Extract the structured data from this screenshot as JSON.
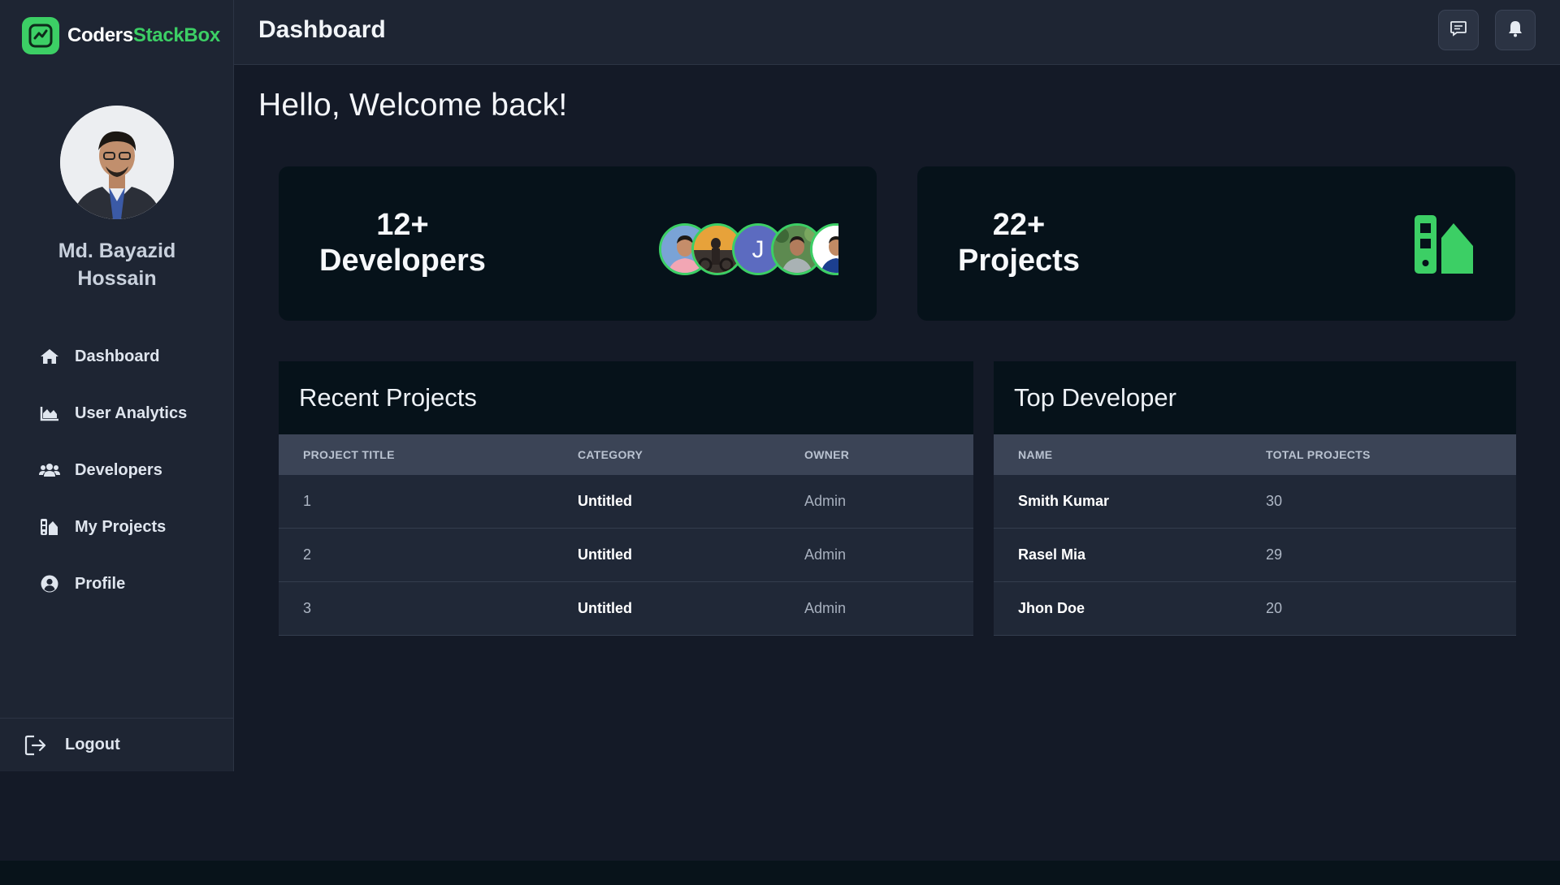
{
  "brand": {
    "name_part1": "Coders",
    "name_part2": "StackBox",
    "accent": "#3ccf65"
  },
  "user": {
    "name_line1": "Md. Bayazid",
    "name_line2": "Hossain"
  },
  "sidebar": {
    "items": [
      {
        "label": "Dashboard",
        "icon": "home-icon"
      },
      {
        "label": "User Analytics",
        "icon": "area-chart-icon"
      },
      {
        "label": "Developers",
        "icon": "users-icon"
      },
      {
        "label": "My Projects",
        "icon": "swatchbook-icon"
      },
      {
        "label": "Profile",
        "icon": "user-circle-icon"
      }
    ],
    "logout_label": "Logout"
  },
  "topbar": {
    "title": "Dashboard",
    "buttons": [
      "message-icon",
      "bell-icon"
    ]
  },
  "main": {
    "welcome": "Hello, Welcome back!",
    "stats": {
      "developers": {
        "value": "12+",
        "label": "Developers"
      },
      "projects": {
        "value": "22+",
        "label": "Projects"
      }
    },
    "developer_avatars": [
      "photo",
      "photo",
      "J",
      "photo",
      "photo"
    ]
  },
  "recent_projects": {
    "title": "Recent Projects",
    "columns": [
      "PROJECT TITLE",
      "CATEGORY",
      "OWNER"
    ],
    "rows": [
      {
        "id": "1",
        "category": "Untitled",
        "owner": "Admin"
      },
      {
        "id": "2",
        "category": "Untitled",
        "owner": "Admin"
      },
      {
        "id": "3",
        "category": "Untitled",
        "owner": "Admin"
      }
    ]
  },
  "top_developer": {
    "title": "Top Developer",
    "columns": [
      "NAME",
      "TOTAL PROJECTS"
    ],
    "rows": [
      {
        "name": "Smith Kumar",
        "projects": "30"
      },
      {
        "name": "Rasel Mia",
        "projects": "29"
      },
      {
        "name": "Jhon Doe",
        "projects": "20"
      }
    ]
  }
}
